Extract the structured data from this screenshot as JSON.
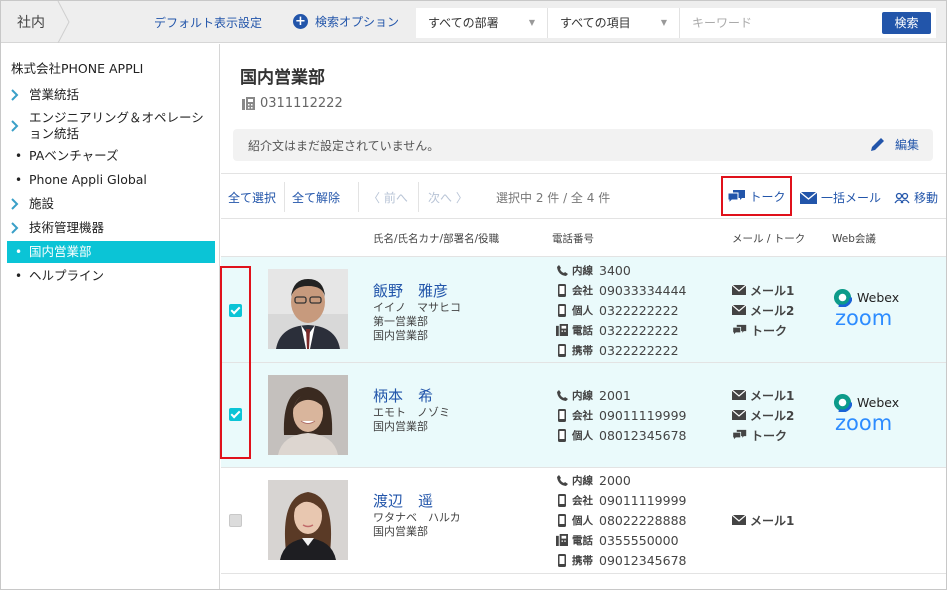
{
  "topbar": {
    "breadcrumb": "社内",
    "default_view": "デフォルト表示設定",
    "search_options": "検索オプション",
    "dept_select": "すべての部署",
    "item_select": "すべての項目",
    "keyword_placeholder": "キーワード",
    "search_button": "検索"
  },
  "sidebar": {
    "company": "株式会社PHONE APPLI",
    "items": [
      {
        "label": "営業統括",
        "type": "folder"
      },
      {
        "label": "エンジニアリング＆オペレーション統括",
        "type": "folder"
      },
      {
        "label": "PAベンチャーズ",
        "type": "leaf"
      },
      {
        "label": "Phone Appli Global",
        "type": "leaf"
      },
      {
        "label": "施設",
        "type": "folder"
      },
      {
        "label": "技術管理機器",
        "type": "folder"
      },
      {
        "label": "国内営業部",
        "type": "leaf",
        "active": true
      },
      {
        "label": "ヘルプライン",
        "type": "leaf"
      }
    ],
    "item_line1": "エンジニアリング＆オペレーシ",
    "item_line2": "ョン統括"
  },
  "main": {
    "dept_name": "国内営業部",
    "dept_phone": "0311112222",
    "intro": "紹介文はまだ設定されていません。",
    "edit": "編集"
  },
  "toolbar": {
    "select_all": "全て選択",
    "deselect_all": "全て解除",
    "prev": "前へ",
    "next": "次へ",
    "status": "選択中 2 件 / 全 4 件",
    "talk": "トーク",
    "bulk_mail": "一括メール",
    "move": "移動"
  },
  "columns": {
    "name": "氏名/氏名カナ/部署名/役職",
    "phone": "電話番号",
    "mail_talk": "メール / トーク",
    "web_meeting": "Web会議"
  },
  "webex_label": "Webex",
  "zoom_label": "zoom",
  "people": [
    {
      "selected": true,
      "name": "飯野　雅彦",
      "kana": "イイノ　マサヒコ",
      "dept1": "第一営業部",
      "dept2": "国内営業部",
      "phones": [
        {
          "icon": "handset-icon",
          "label": "内線",
          "number": "3400"
        },
        {
          "icon": "mobile-icon",
          "label": "会社",
          "number": "09033334444"
        },
        {
          "icon": "mobile-icon",
          "label": "個人",
          "number": "0322222222"
        },
        {
          "icon": "fax-icon",
          "label": "電話",
          "number": "0322222222"
        },
        {
          "icon": "mobile-icon",
          "label": "携帯",
          "number": "0322222222"
        }
      ],
      "contacts": [
        "メール1",
        "メール2",
        "トーク"
      ]
    },
    {
      "selected": true,
      "name": "柄本　希",
      "kana": "エモト　ノゾミ",
      "dept1": "国内営業部",
      "phones": [
        {
          "icon": "handset-icon",
          "label": "内線",
          "number": "2001"
        },
        {
          "icon": "mobile-icon",
          "label": "会社",
          "number": "09011119999"
        },
        {
          "icon": "mobile-icon",
          "label": "個人",
          "number": "08012345678"
        }
      ],
      "contacts": [
        "メール1",
        "メール2",
        "トーク"
      ]
    },
    {
      "selected": false,
      "name": "渡辺　遥",
      "kana": "ワタナベ　ハルカ",
      "dept1": "国内営業部",
      "phones": [
        {
          "icon": "handset-icon",
          "label": "内線",
          "number": "2000"
        },
        {
          "icon": "mobile-icon",
          "label": "会社",
          "number": "09011119999"
        },
        {
          "icon": "mobile-icon",
          "label": "個人",
          "number": "08022228888"
        },
        {
          "icon": "fax-icon",
          "label": "電話",
          "number": "0355550000"
        },
        {
          "icon": "mobile-icon",
          "label": "携帯",
          "number": "09012345678"
        }
      ],
      "contacts": [
        "メール1"
      ]
    }
  ]
}
